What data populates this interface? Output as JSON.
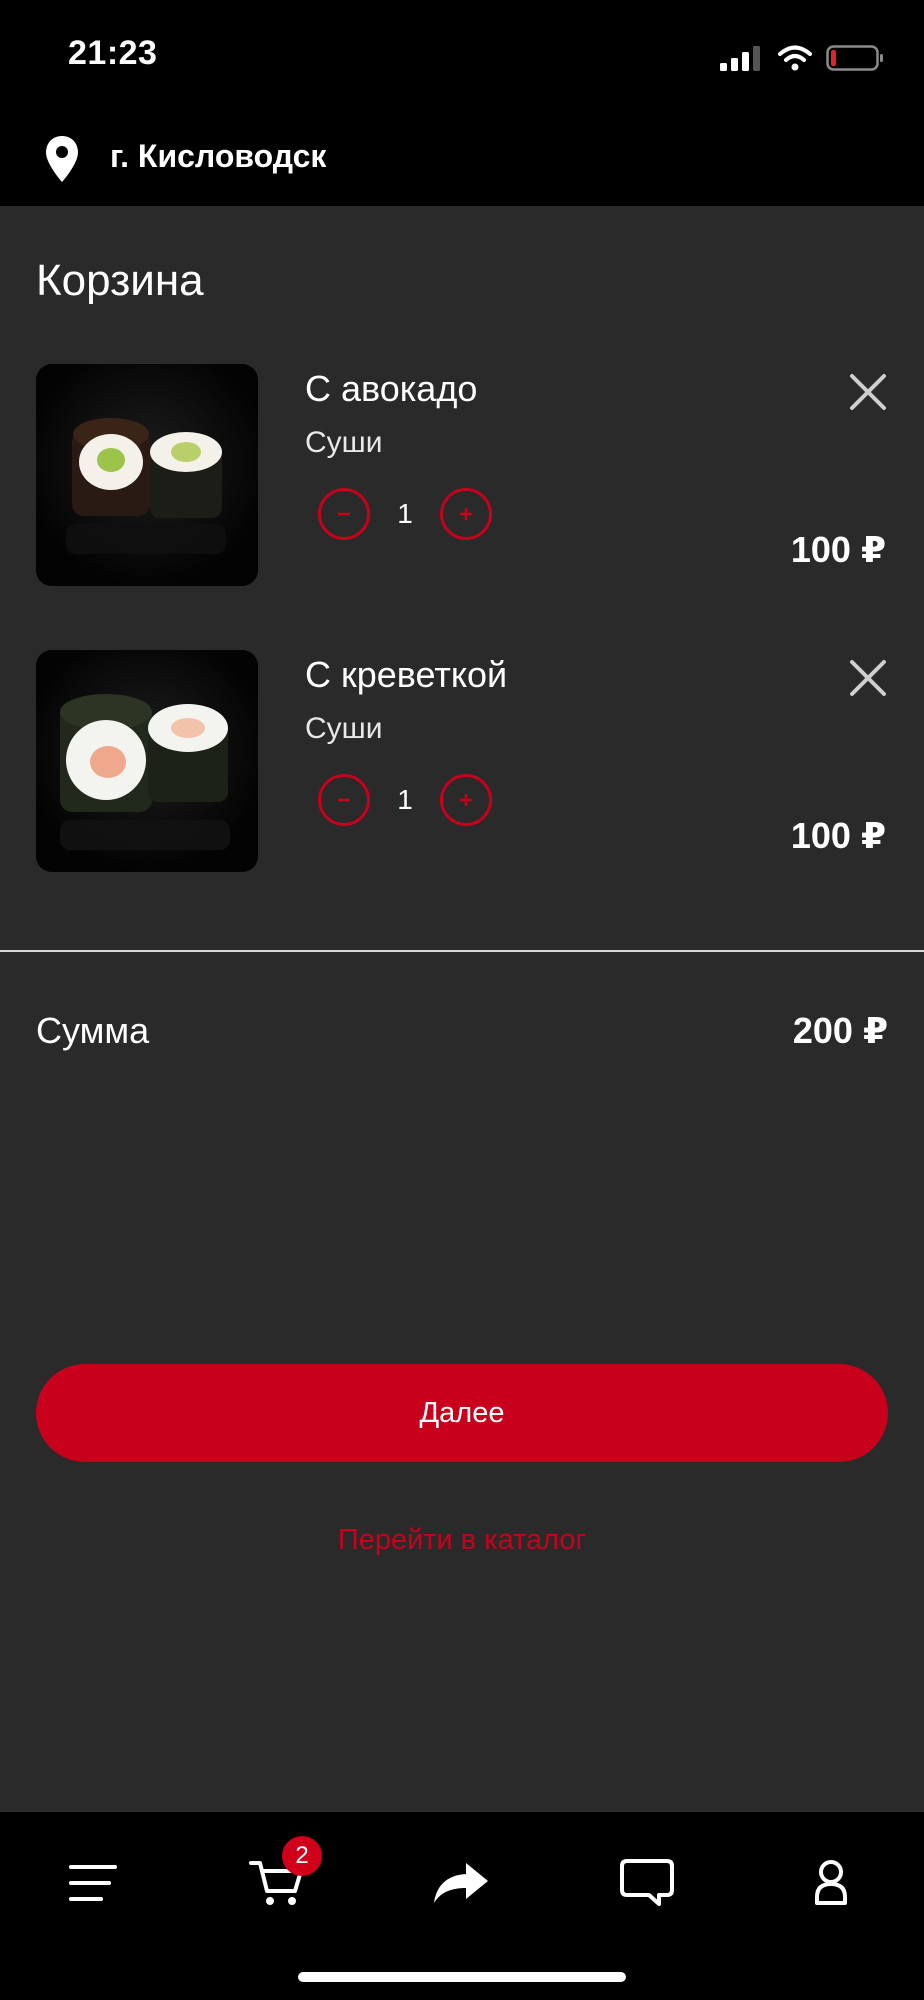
{
  "status_bar": {
    "time": "21:23",
    "icons": [
      "signal-icon",
      "wifi-icon",
      "battery-low-icon"
    ]
  },
  "header": {
    "location_icon": "map-pin-icon",
    "city": "г. Кисловодск"
  },
  "cart": {
    "title": "Корзина",
    "items": [
      {
        "name": "С авокадо",
        "category": "Суши",
        "quantity": "1",
        "price": "100 ₽",
        "image": "sushi-avocado-image"
      },
      {
        "name": "С креветкой",
        "category": "Суши",
        "quantity": "1",
        "price": "100 ₽",
        "image": "sushi-shrimp-image"
      }
    ],
    "summary_label": "Сумма",
    "summary_value": "200 ₽",
    "next_button": "Далее",
    "catalog_link": "Перейти в каталог"
  },
  "tab_bar": {
    "tabs": [
      "menu-icon",
      "cart-icon",
      "share-icon",
      "chat-icon",
      "profile-icon"
    ],
    "cart_badge": "2"
  },
  "colors": {
    "accent": "#c8001b",
    "background": "#2a2a2b",
    "bars": "#000000"
  }
}
